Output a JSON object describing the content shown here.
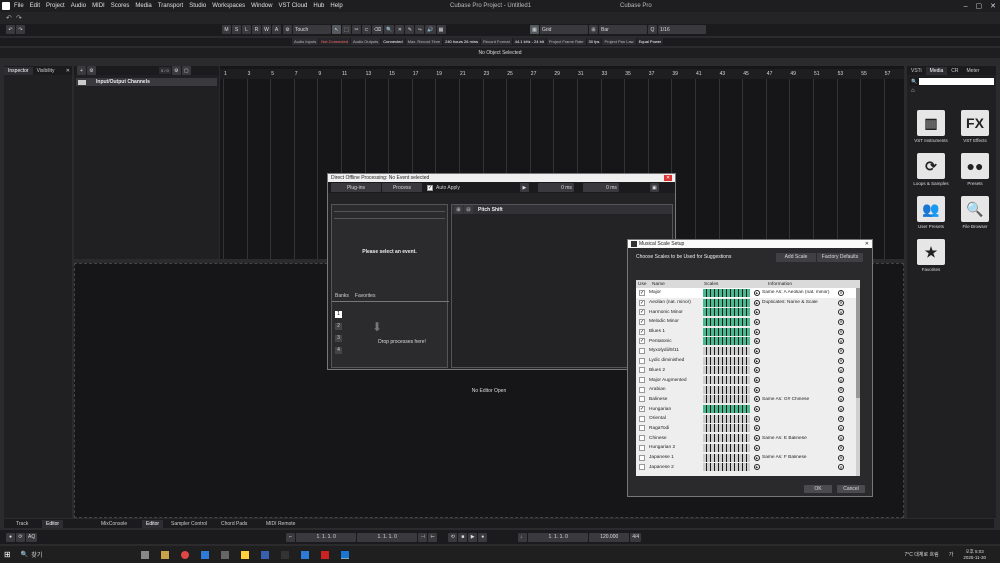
{
  "app": {
    "title": "Cubase Pro Project - Untitled1",
    "right_title": "Cubase Pro"
  },
  "menu": [
    "File",
    "Edit",
    "Project",
    "Audio",
    "MIDI",
    "Scores",
    "Media",
    "Transport",
    "Studio",
    "Workspaces",
    "Window",
    "VST Cloud",
    "Hub",
    "Help"
  ],
  "toolbar": {
    "mode_buttons": [
      "M",
      "S",
      "L",
      "R",
      "W",
      "A"
    ],
    "automation_mode": "Touch",
    "snap": "Grid",
    "quantize_grid": "Bar",
    "quantize": "1/16"
  },
  "status": {
    "items": [
      {
        "label": "Audio Inputs",
        "value": "Not Connected",
        "alert": true
      },
      {
        "label": "Audio Outputs",
        "value": "Connected"
      },
      {
        "label": "Max. Record Time",
        "value": "240 hours 26 mins"
      },
      {
        "label": "Record Format",
        "value": "44.1 kHz - 24 bit"
      },
      {
        "label": "Project Frame Rate",
        "value": "30 fps"
      },
      {
        "label": "Project Pan Law",
        "value": "Equal Power"
      }
    ],
    "info": "No Object Selected"
  },
  "left_zone": {
    "tabs": [
      "Inspector",
      "Visibility"
    ],
    "counter": "0 / 0",
    "track_folder": "Input/Output Channels"
  },
  "ruler": [
    1,
    3,
    5,
    7,
    9,
    11,
    13,
    15,
    17,
    19,
    21,
    23,
    25,
    27,
    29,
    31,
    33,
    35,
    37,
    39,
    41,
    43,
    45,
    47,
    49,
    51,
    53,
    55,
    57
  ],
  "lower_zone": {
    "message": "No Editor Open",
    "tabs": [
      "Track",
      "Editor",
      "MixConsole",
      "Editor",
      "Sampler Control",
      "Chord Pads",
      "MIDI Remote"
    ]
  },
  "dop": {
    "title": "Direct Offline Processing: No Event selected",
    "plugins_label": "Plug-ins",
    "process_label": "Process",
    "auto_apply": "Auto Apply",
    "time1": "0 ms",
    "time2": "0 ms",
    "placeholder": "Please select an event.",
    "banks_label": "Banks",
    "favorites_label": "Favorites",
    "bank_numbers": [
      "1",
      "2",
      "3",
      "4"
    ],
    "drop_text": "Drop processes here!",
    "selected_process": "Pitch Shift"
  },
  "scale_dialog": {
    "title": "Musical Scale Setup",
    "header": "Choose Scales to be Used for Suggestions",
    "add_button": "Add Scale",
    "factory_button": "Factory Defaults",
    "columns": [
      "Use",
      "Name",
      "Scales",
      "Information"
    ],
    "rows": [
      {
        "use": true,
        "name": "Major",
        "info": "Same As: A Aeolian (nat. minor)"
      },
      {
        "use": true,
        "name": "Aeolian (nat. minor)",
        "info": "Duplicates: Name & Scale"
      },
      {
        "use": true,
        "name": "Harmonic Minor",
        "info": ""
      },
      {
        "use": true,
        "name": "Melodic Minor",
        "info": ""
      },
      {
        "use": true,
        "name": "Blues 1",
        "info": ""
      },
      {
        "use": true,
        "name": "Pentatonic",
        "info": ""
      },
      {
        "use": false,
        "name": "Myxolydii/9/11",
        "info": ""
      },
      {
        "use": false,
        "name": "Lydic diminished",
        "info": ""
      },
      {
        "use": false,
        "name": "Blues 2",
        "info": ""
      },
      {
        "use": false,
        "name": "Major Augmented",
        "info": ""
      },
      {
        "use": false,
        "name": "Arabian",
        "info": ""
      },
      {
        "use": false,
        "name": "Balinese",
        "info": "Same As: G# Chinese"
      },
      {
        "use": true,
        "name": "Hungarian",
        "info": ""
      },
      {
        "use": false,
        "name": "Oriental",
        "info": ""
      },
      {
        "use": false,
        "name": "RagaTodi",
        "info": ""
      },
      {
        "use": false,
        "name": "Chinese",
        "info": "Same As: E Balinese"
      },
      {
        "use": false,
        "name": "Hungarian 2",
        "info": ""
      },
      {
        "use": false,
        "name": "Japanese 1",
        "info": "Same As: F Balinese"
      },
      {
        "use": false,
        "name": "Japanese 2",
        "info": ""
      }
    ],
    "ok": "OK",
    "cancel": "Cancel"
  },
  "right_zone": {
    "tabs": [
      "VSTi",
      "Media",
      "CR",
      "Meter"
    ],
    "items": [
      {
        "label": "VST Instruments",
        "icon": "piano-icon"
      },
      {
        "label": "VST Effects",
        "icon": "fx-icon"
      },
      {
        "label": "Loops & Samples",
        "icon": "loop-icon"
      },
      {
        "label": "Presets",
        "icon": "presets-icon"
      },
      {
        "label": "User Presets",
        "icon": "user-presets-icon"
      },
      {
        "label": "File Browser",
        "icon": "file-browser-icon"
      },
      {
        "label": "Favorites",
        "icon": "star-icon"
      }
    ]
  },
  "transport": {
    "left_locator": "1. 1. 1. 0",
    "right_locator": "1. 1. 1. 0",
    "position": "1. 1. 1. 0",
    "tempo": "120.000",
    "signature": "4/4"
  },
  "taskbar": {
    "search": "찾기",
    "time": "오후 5:03",
    "date": "2025-11-30",
    "weather": "7°C 대체로 흐림",
    "lang": "가"
  }
}
